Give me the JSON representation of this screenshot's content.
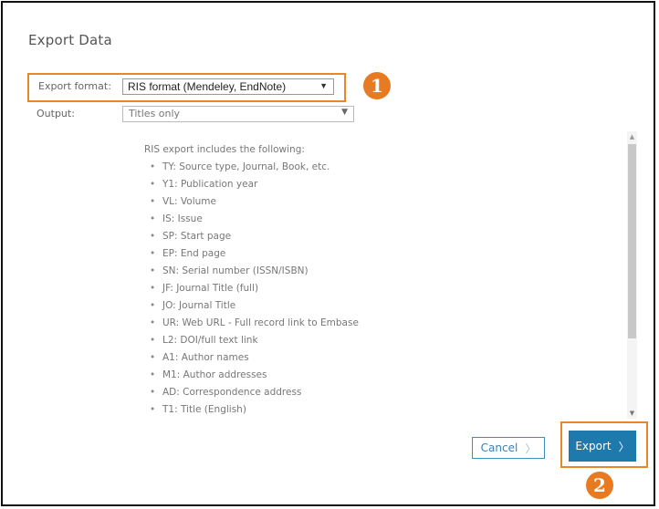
{
  "dialog": {
    "title": "Export Data"
  },
  "export_format": {
    "label": "Export format:",
    "selected": "RIS format (Mendeley, EndNote)",
    "caret": "▼"
  },
  "output": {
    "label": "Output:",
    "selected": "Titles only",
    "caret": "▼"
  },
  "annotations": {
    "badge_1": "1",
    "badge_2": "2",
    "highlight_color": "#e8872a"
  },
  "info": {
    "intro": "RIS export includes the following:",
    "items": [
      "TY: Source type, Journal, Book, etc.",
      "Y1: Publication year",
      "VL: Volume",
      "IS: Issue",
      "SP: Start page",
      "EP: End page",
      "SN: Serial number (ISSN/ISBN)",
      "JF: Journal Title (full)",
      "JO: Journal Title",
      "UR: Web URL - Full record link to Embase",
      "L2: DOI/full text link",
      "A1: Author names",
      "M1: Author addresses",
      "AD: Correspondence address",
      "T1: Title (English)"
    ]
  },
  "buttons": {
    "cancel_label": "Cancel",
    "export_label": "Export",
    "chevron": "〉",
    "export_color": "#1e7aad"
  },
  "scrollbar": {
    "up_arrow": "▲",
    "down_arrow": "▼"
  }
}
